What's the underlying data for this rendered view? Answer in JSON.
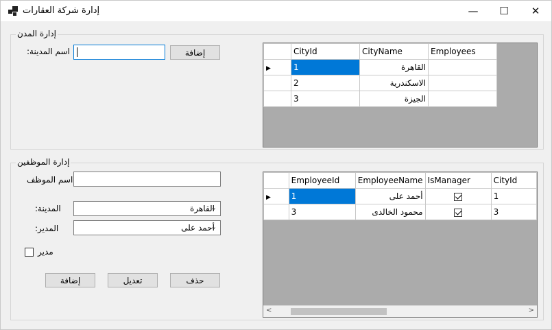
{
  "window": {
    "title": "إدارة شركة العقارات",
    "minimize_glyph": "—",
    "maximize_glyph": "☐",
    "close_glyph": "✕"
  },
  "cities_group": {
    "title": "إدارة المدن",
    "city_name_label": ":اسم المدينة",
    "city_name_value": "",
    "add_button": "إضافة",
    "grid": {
      "columns": [
        "CityId",
        "CityName",
        "Employees"
      ],
      "rows": [
        {
          "id": "1",
          "name": "القاهرة",
          "employees": ""
        },
        {
          "id": "2",
          "name": "الاسكندرية",
          "employees": ""
        },
        {
          "id": "3",
          "name": "الجيزة",
          "employees": ""
        }
      ],
      "current_row_glyph": "▶"
    }
  },
  "employees_group": {
    "title": "إدارة الموظفين",
    "employee_name_label": "اسم الموظف:",
    "employee_name_value": "",
    "city_label": ":المدينة",
    "city_value": "القاهرة",
    "manager_label": ":المدير",
    "manager_value": "أحمد على",
    "is_manager_label": "مدير",
    "is_manager_checked": false,
    "delete_button": "حذف",
    "edit_button": "تعديل",
    "add_button": "إضافة",
    "combo_arrow_glyph": "⌄",
    "grid": {
      "columns": [
        "EmployeeId",
        "EmployeeName",
        "IsManager",
        "CityId"
      ],
      "rows": [
        {
          "id": "1",
          "name": "أحمد على",
          "is_manager": true,
          "city_id": "1"
        },
        {
          "id": "3",
          "name": "محمود الخالدى",
          "is_manager": true,
          "city_id": "3"
        }
      ],
      "current_row_glyph": "▶",
      "scroll_left_glyph": "<",
      "scroll_right_glyph": ">"
    }
  }
}
